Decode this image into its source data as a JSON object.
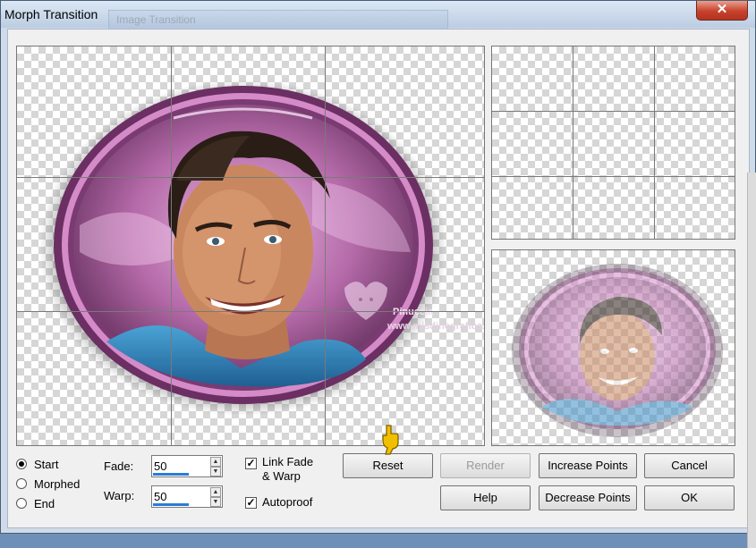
{
  "window": {
    "title": "Morph Transition",
    "background_tab_title": "Image Transition",
    "close_glyph": "✕"
  },
  "previews": {
    "main_panel": "start-frame-with-warp-grid",
    "top_right_panel": "end-frame-grid",
    "bottom_right_panel": "morphed-preview"
  },
  "watermark": {
    "line1": "Pinuccia",
    "line2": "www.misdinegrafica.eu"
  },
  "frame_options": {
    "options": [
      {
        "label": "Start",
        "selected": true
      },
      {
        "label": "Morphed",
        "selected": false
      },
      {
        "label": "End",
        "selected": false
      }
    ]
  },
  "fade": {
    "label": "Fade:",
    "value": "50"
  },
  "warp": {
    "label": "Warp:",
    "value": "50"
  },
  "link_fade_warp": {
    "label_line1": "Link Fade",
    "label_line2": "& Warp",
    "checked": true
  },
  "autoproof": {
    "label": "Autoproof",
    "checked": true
  },
  "buttons": {
    "reset": "Reset",
    "render": "Render",
    "increase_points": "Increase Points",
    "cancel": "Cancel",
    "help": "Help",
    "decrease_points": "Decrease Points",
    "ok": "OK"
  },
  "colors": {
    "frame_purple": "#8e4a86",
    "title_bar": "#cfdbe9",
    "close_red": "#c7412b",
    "dialog_bg": "#f0f0f0",
    "hand_cursor": "#f0c000"
  }
}
